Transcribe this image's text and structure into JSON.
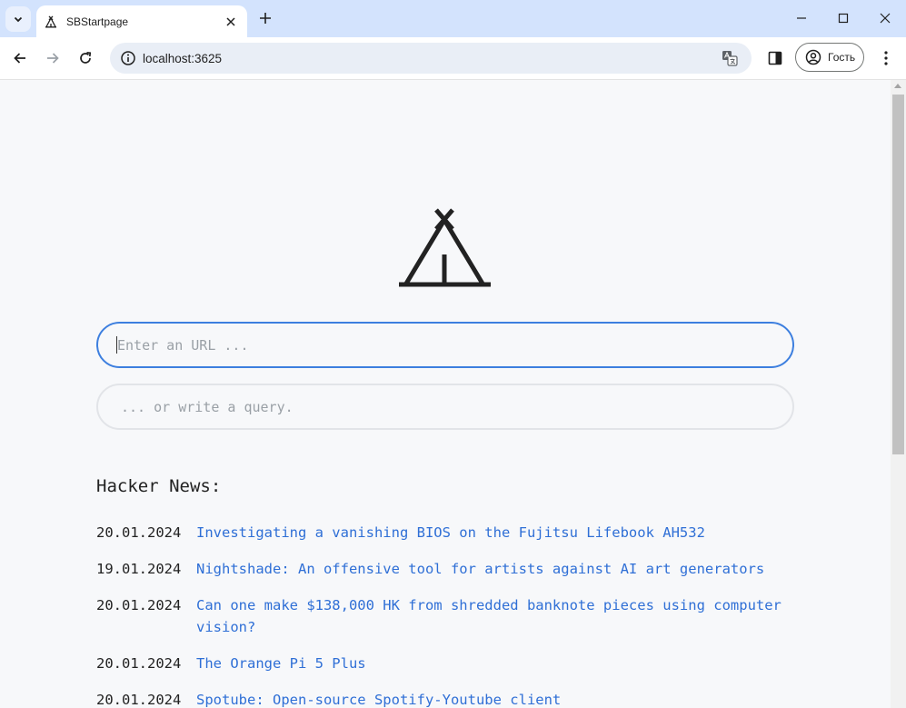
{
  "browser": {
    "tab": {
      "title": "SBStartpage",
      "favicon": "tent-icon"
    },
    "address": {
      "url": "localhost:3625"
    },
    "profile": {
      "label": "Гость"
    }
  },
  "page": {
    "logo": "tent-icon",
    "url_input": {
      "placeholder": "Enter an URL ..."
    },
    "query_input": {
      "placeholder": "... or write a query."
    },
    "hacker_news": {
      "heading": "Hacker News:",
      "items": [
        {
          "date": "20.01.2024",
          "title": "Investigating a vanishing BIOS on the Fujitsu Lifebook AH532"
        },
        {
          "date": "19.01.2024",
          "title": "Nightshade: An offensive tool for artists against AI art generators"
        },
        {
          "date": "20.01.2024",
          "title": "Can one make $138,000 HK from shredded banknote pieces using computer vision?"
        },
        {
          "date": "20.01.2024",
          "title": "The Orange Pi 5 Plus"
        },
        {
          "date": "20.01.2024",
          "title": "Spotube: Open-source Spotify-Youtube client"
        }
      ]
    }
  },
  "colors": {
    "accent": "#3d7fdf",
    "link": "#2f6fd6",
    "background": "#f7f8fa"
  }
}
